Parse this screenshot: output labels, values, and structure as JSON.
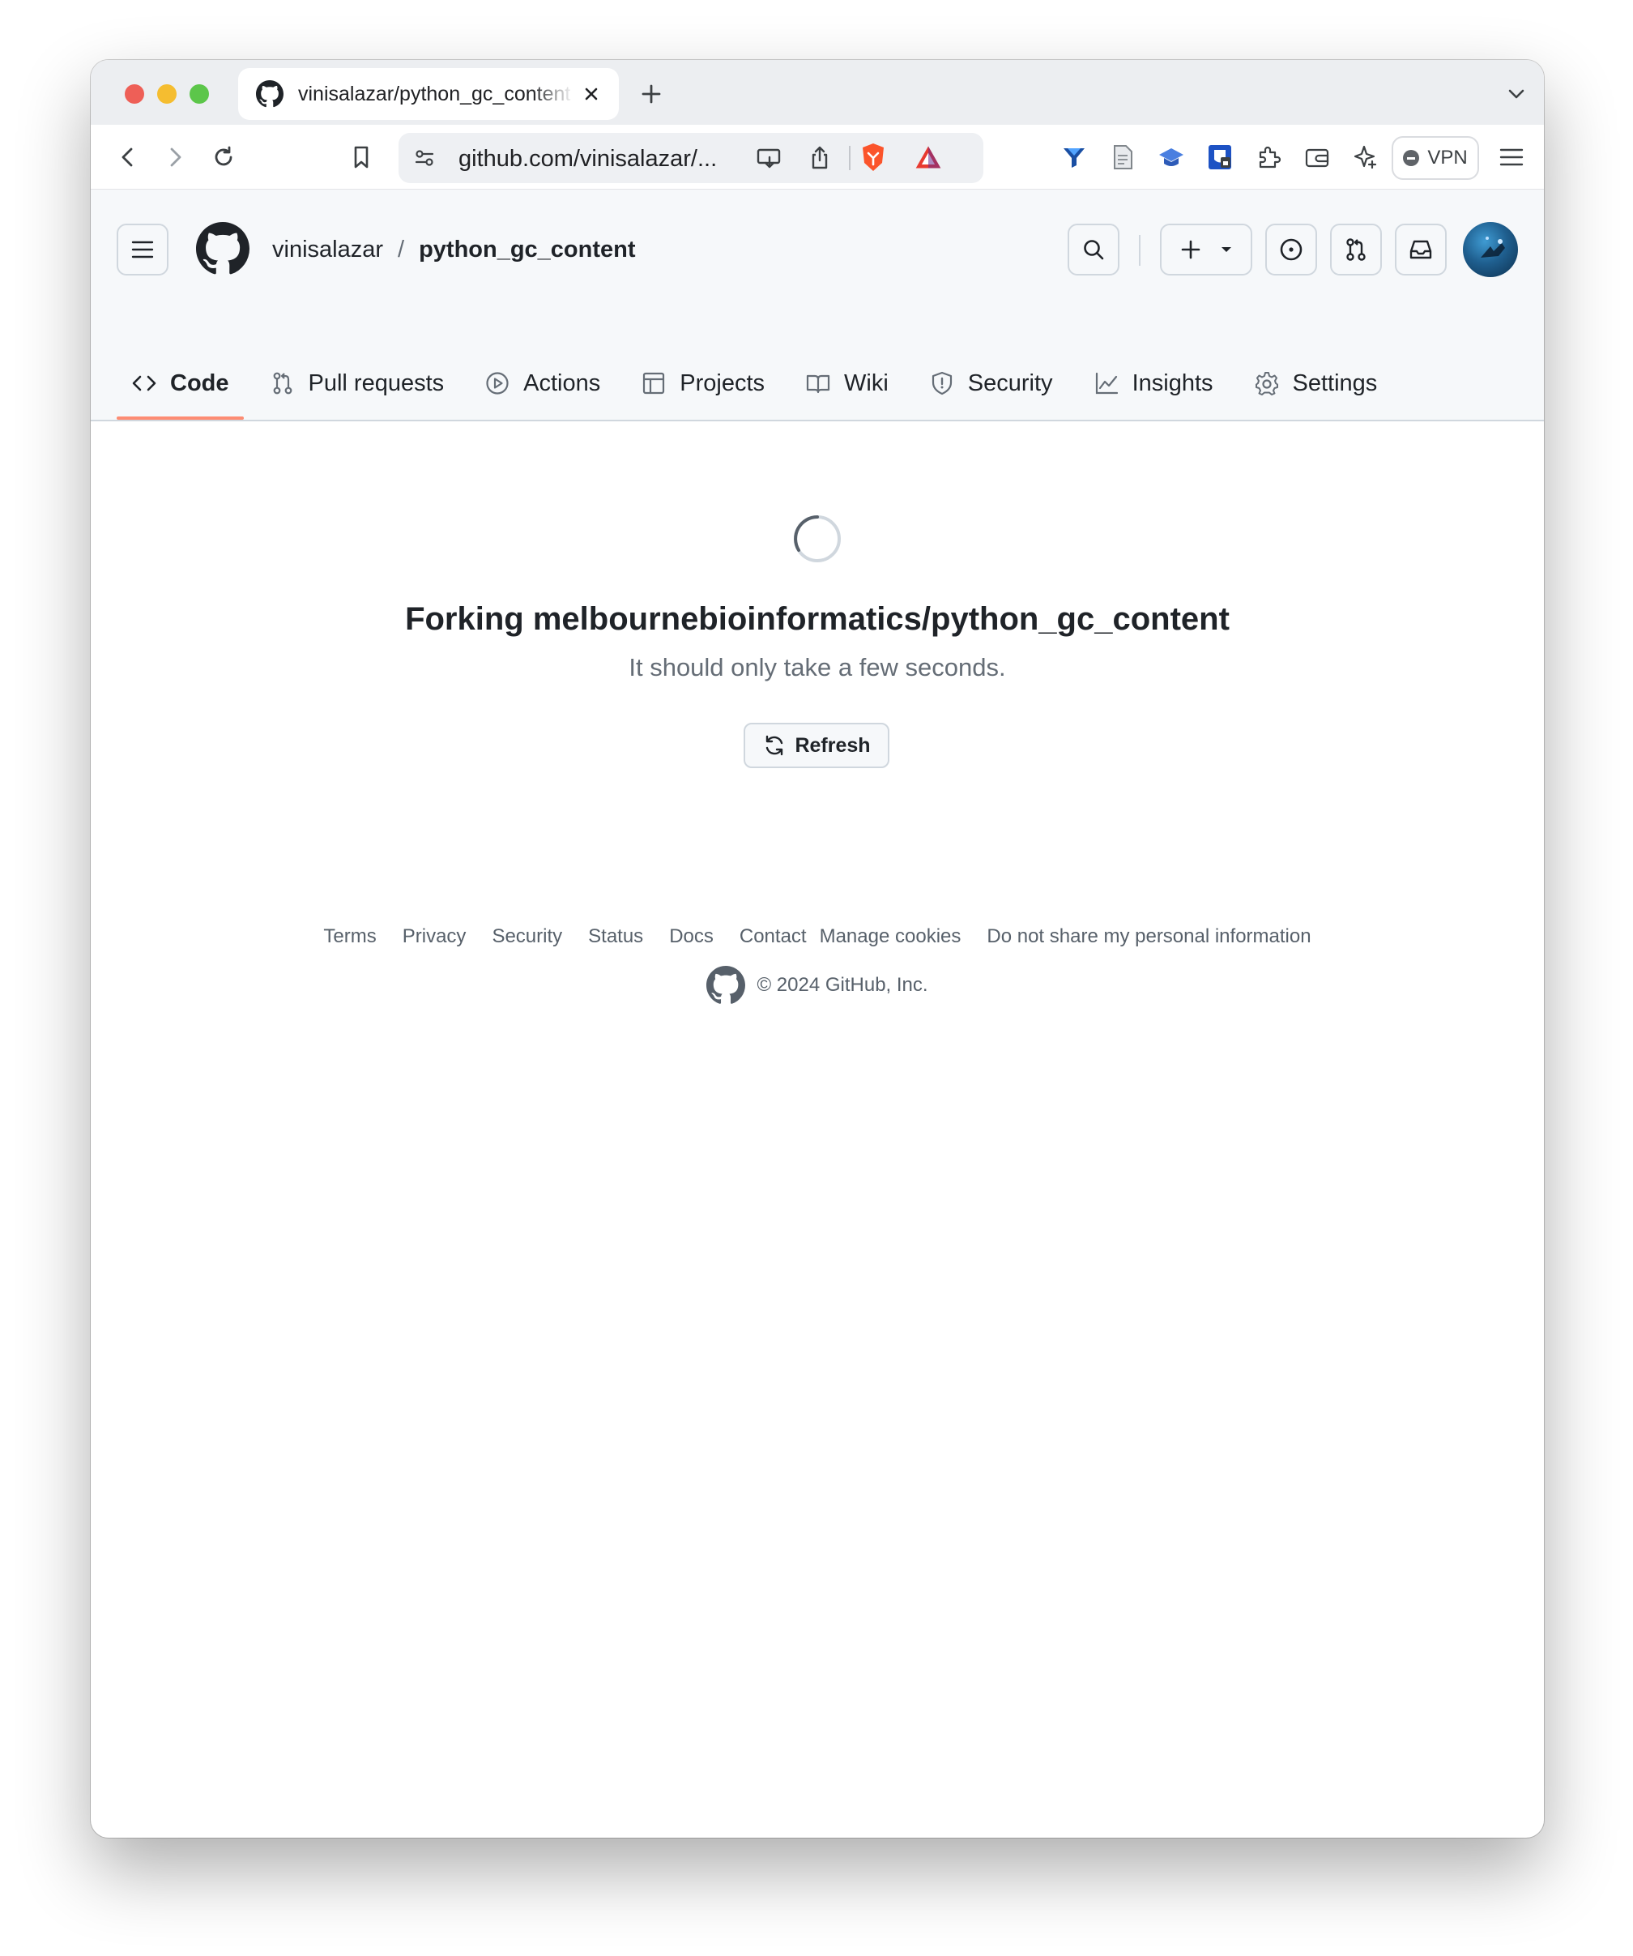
{
  "browser": {
    "tab_title": "vinisalazar/python_gc_content",
    "url": "github.com/vinisalazar/...",
    "vpn_label": "VPN"
  },
  "header": {
    "owner": "vinisalazar",
    "separator": "/",
    "repo": "python_gc_content"
  },
  "nav": {
    "items": [
      {
        "label": "Code",
        "icon": "code-icon",
        "selected": true
      },
      {
        "label": "Pull requests",
        "icon": "pull-request-icon"
      },
      {
        "label": "Actions",
        "icon": "play-icon"
      },
      {
        "label": "Projects",
        "icon": "table-icon"
      },
      {
        "label": "Wiki",
        "icon": "book-icon"
      },
      {
        "label": "Security",
        "icon": "shield-icon"
      },
      {
        "label": "Insights",
        "icon": "graph-icon"
      },
      {
        "label": "Settings",
        "icon": "gear-icon"
      }
    ]
  },
  "main": {
    "heading": "Forking melbournebioinformatics/python_gc_content",
    "subtext": "It should only take a few seconds.",
    "refresh_label": "Refresh"
  },
  "footer": {
    "links": [
      "Terms",
      "Privacy",
      "Security",
      "Status",
      "Docs",
      "Contact",
      "Manage cookies",
      "Do not share my personal information"
    ],
    "copyright": "© 2024 GitHub, Inc."
  },
  "colors": {
    "accent_underline": "#fd8c73",
    "text_primary": "#1f2328",
    "text_muted": "#656d76",
    "header_bg": "#f6f8fa"
  }
}
